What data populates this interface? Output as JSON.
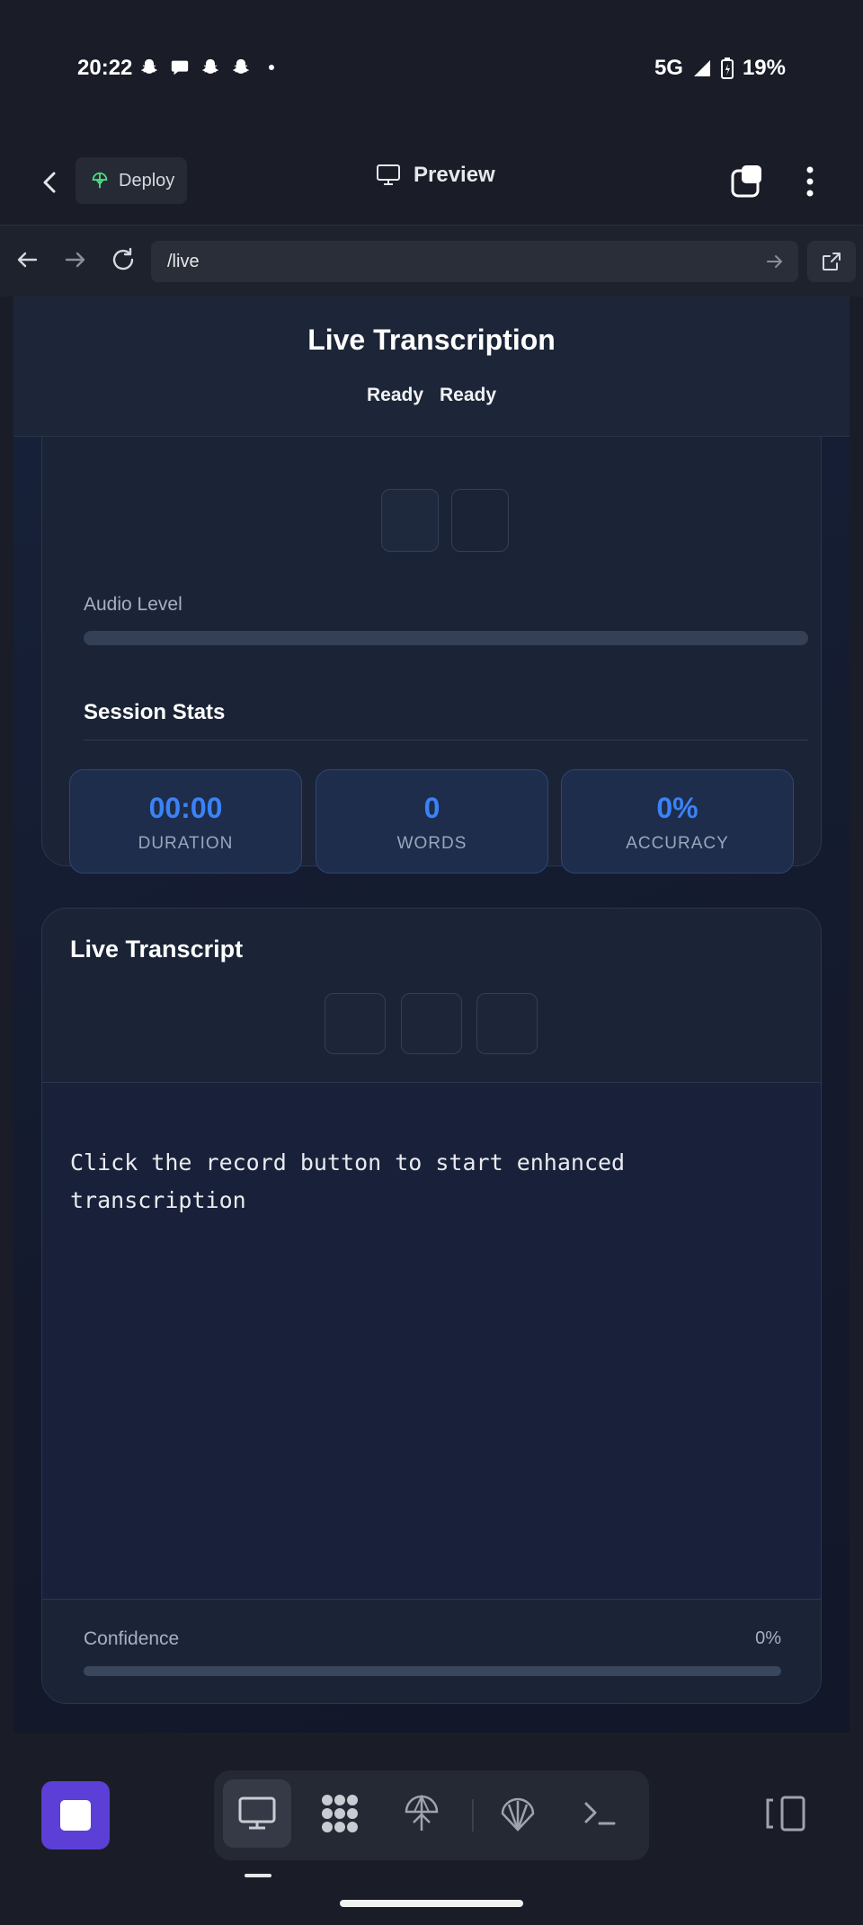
{
  "status_bar": {
    "time": "20:22",
    "notification_icons": [
      "snapchat-icon",
      "chat-bubble-icon",
      "snapchat-icon",
      "snapchat-icon",
      "dot-icon"
    ],
    "network": "5G",
    "battery": "19%"
  },
  "app_bar": {
    "deploy_label": "Deploy",
    "preview_label": "Preview"
  },
  "browser": {
    "url": "/live"
  },
  "page": {
    "title": "Live Transcription",
    "status_1": "Ready",
    "status_2": "Ready",
    "audio_level_label": "Audio Level",
    "audio_level": 0,
    "session_stats_title": "Session Stats",
    "stats": [
      {
        "value": "00:00",
        "label": "DURATION"
      },
      {
        "value": "0",
        "label": "WORDS"
      },
      {
        "value": "0%",
        "label": "ACCURACY"
      }
    ],
    "transcript_title": "Live Transcript",
    "transcript_placeholder": "Click the record button to start enhanced transcription",
    "confidence_label": "Confidence",
    "confidence_value": "0%",
    "confidence": 0
  },
  "accent_color": "#3b82f6",
  "bottom_bar": {
    "dock_items": [
      "desktop-icon",
      "apps-icon",
      "deploy-icon",
      "shell-icon",
      "terminal-icon"
    ]
  }
}
